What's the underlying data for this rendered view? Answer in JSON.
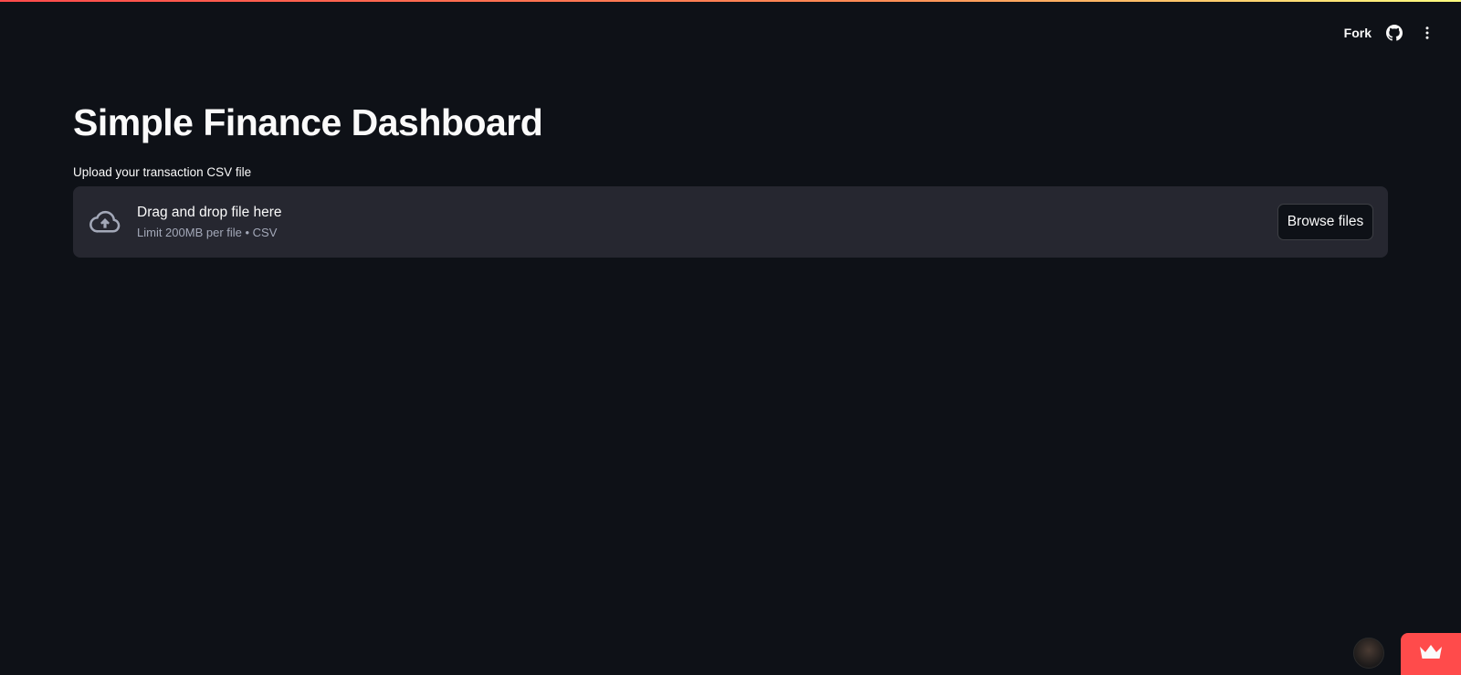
{
  "header": {
    "fork_label": "Fork",
    "github_icon": "github-icon",
    "menu_icon": "more-vert-icon"
  },
  "main": {
    "title": "Simple Finance Dashboard",
    "uploader": {
      "label": "Upload your transaction CSV file",
      "instructions": "Drag and drop file here",
      "limit_text": "Limit 200MB per file • CSV",
      "browse_label": "Browse files",
      "icon": "cloud-upload-icon"
    }
  },
  "footer": {
    "avatar_icon": "avatar",
    "badge_icon": "crown-icon"
  },
  "colors": {
    "background": "#0e1117",
    "surface": "#262730",
    "text": "#fafafa",
    "muted_text": "#a3a8b8",
    "accent": "#ff4b4b"
  }
}
